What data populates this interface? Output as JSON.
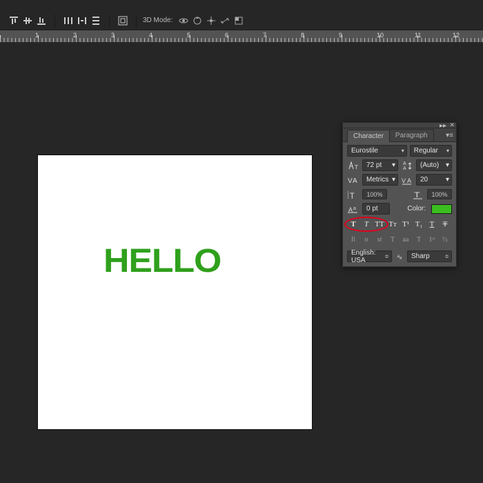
{
  "toolbar": {
    "d3_label": "3D Mode:"
  },
  "canvas": {
    "text": "HELLO",
    "text_color": "#2fa01c"
  },
  "panel": {
    "tabs": {
      "character": "Character",
      "paragraph": "Paragraph"
    },
    "font_family": "Eurostile",
    "font_style": "Regular",
    "size": "72 pt",
    "leading": "(Auto)",
    "kerning": "Metrics",
    "tracking": "20",
    "v_scale": "100%",
    "h_scale": "100%",
    "baseline": "0 pt",
    "color_label": "Color:",
    "color_value": "#3bbf1f",
    "styles": {
      "bold": "T",
      "italic": "T",
      "allcaps": "TT",
      "smallcaps": "Tᴛ",
      "superscript": "T¹",
      "subscript": "T₁",
      "underline": "T",
      "strike": "T"
    },
    "opentype": {
      "fi": "fi",
      "ordinals": "o",
      "swash": "st",
      "titling": "T",
      "calt": "aa",
      "frac": "T",
      "num": "1ˢᵗ",
      "half": "½"
    },
    "language": "English: USA",
    "antialias": "Sharp"
  }
}
